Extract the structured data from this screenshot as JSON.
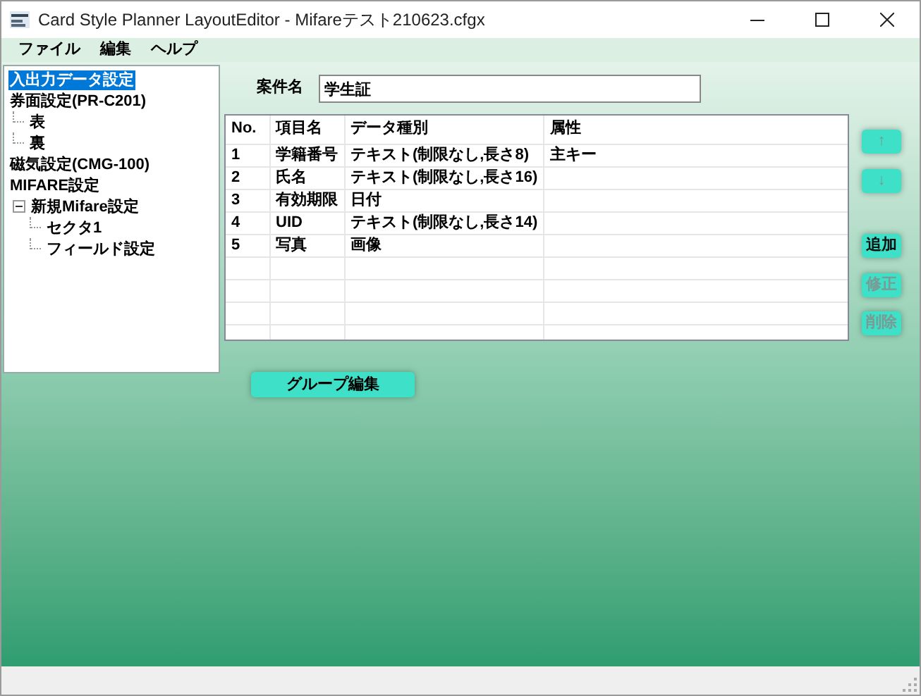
{
  "window": {
    "title": "Card Style Planner LayoutEditor - Mifareテスト210623.cfgx"
  },
  "menu": [
    "ファイル",
    "編集",
    "ヘルプ"
  ],
  "tree": [
    {
      "label": "入出力データ設定",
      "selected": true
    },
    {
      "label": "券面設定(PR-C201)",
      "selected": false,
      "children": [
        {
          "label": "表",
          "selected": false
        },
        {
          "label": "裏",
          "selected": false
        }
      ]
    },
    {
      "label": "磁気設定(CMG-100)",
      "selected": false
    },
    {
      "label": "MIFARE設定",
      "selected": false,
      "children": [
        {
          "label": "新規Mifare設定",
          "selected": false,
          "expanded": true,
          "children": [
            {
              "label": "セクタ1",
              "selected": false
            },
            {
              "label": "フィールド設定",
              "selected": false
            }
          ]
        }
      ]
    }
  ],
  "case_name": {
    "label": "案件名",
    "value": "学生証"
  },
  "table": {
    "columns": [
      "No.",
      "項目名",
      "データ種別",
      "属性"
    ],
    "rows": [
      [
        "1",
        "学籍番号",
        "テキスト(制限なし,長さ8)",
        "主キー"
      ],
      [
        "2",
        "氏名",
        "テキスト(制限なし,長さ16)",
        ""
      ],
      [
        "3",
        "有効期限",
        "日付",
        ""
      ],
      [
        "4",
        "UID",
        "テキスト(制限なし,長さ14)",
        ""
      ],
      [
        "5",
        "写真",
        "画像",
        ""
      ]
    ]
  },
  "side_buttons": [
    {
      "label": "↑",
      "disabled": true
    },
    {
      "label": "↓",
      "disabled": true
    },
    {
      "label": "追加",
      "disabled": false
    },
    {
      "label": "修正",
      "disabled": true
    },
    {
      "label": "削除",
      "disabled": true
    }
  ],
  "group_edit_button": {
    "label": "グループ編集"
  }
}
